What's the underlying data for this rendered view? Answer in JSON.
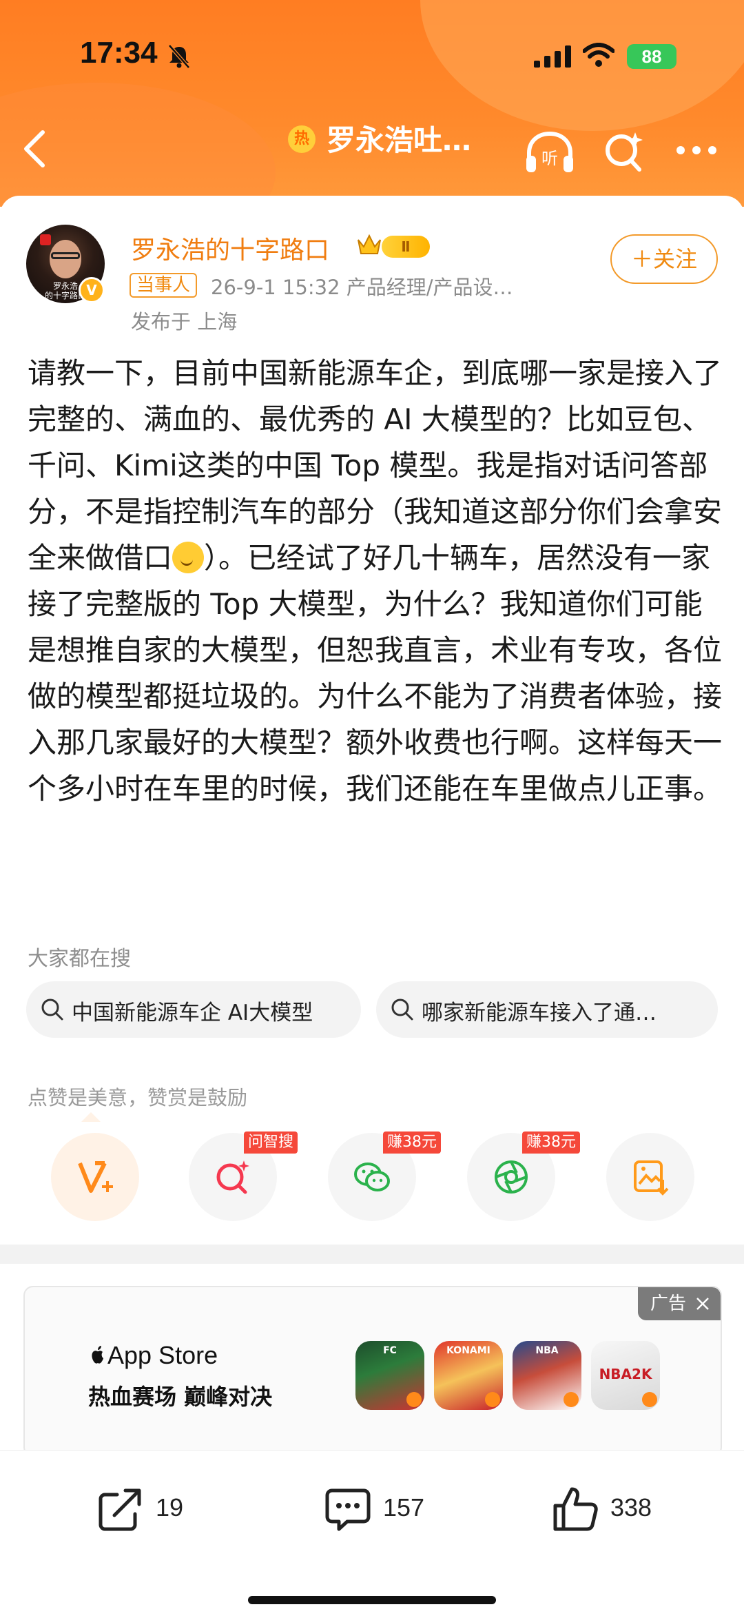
{
  "status_bar": {
    "time": "17:34",
    "battery": "88"
  },
  "nav": {
    "hot_badge": "热",
    "title": "罗永浩吐…"
  },
  "author": {
    "name": "罗永浩的十字路口",
    "level": "Ⅱ",
    "role_tag": "当事人",
    "meta": "26-9-1 15:32  产品经理/产品设…",
    "location": "发布于 上海",
    "avatar_caption": "罗永浩\n的十字路口",
    "verified": "V"
  },
  "follow": {
    "label": "＋关注"
  },
  "post": {
    "text_part1": "请教一下，目前中国新能源车企，到底哪一家是接入了完整的、满血的、最优秀的 AI 大模型的？比如豆包、千问、Kimi这类的中国 Top 模型。我是指对话问答部分，不是指控制汽车的部分（我知道这部分你们会拿安全来做借口",
    "text_part2": "）。已经试了好几十辆车，居然没有一家接了完整版的 Top 大模型，为什么？我知道你们可能是想推自家的大模型，但恕我直言，术业有专攻，各位做的模型都挺垃圾的。为什么不能为了消费者体验，接入那几家最好的大模型？额外收费也行啊。这样每天一个多小时在车里的时候，我们还能在车里做点儿正事。"
  },
  "search": {
    "title": "大家都在搜",
    "chips": [
      "中国新能源车企 AI大模型",
      "哪家新能源车接入了通…"
    ]
  },
  "reward": {
    "hint": "点赞是美意，赞赏是鼓励",
    "tags": [
      "问智搜",
      "赚38元",
      "赚38元"
    ]
  },
  "ad": {
    "tag": "广告",
    "brand": "App Store",
    "slogan": "热血赛场 巅峰对决",
    "games": [
      "FC",
      "KONAMI",
      "NBA",
      "NBA2K"
    ]
  },
  "bottom_bar": {
    "repost_count": "19",
    "comment_count": "157",
    "like_count": "338"
  },
  "colors": {
    "header": "#ff7d22",
    "accent": "#f08a10",
    "red_tag": "#f5483a"
  }
}
